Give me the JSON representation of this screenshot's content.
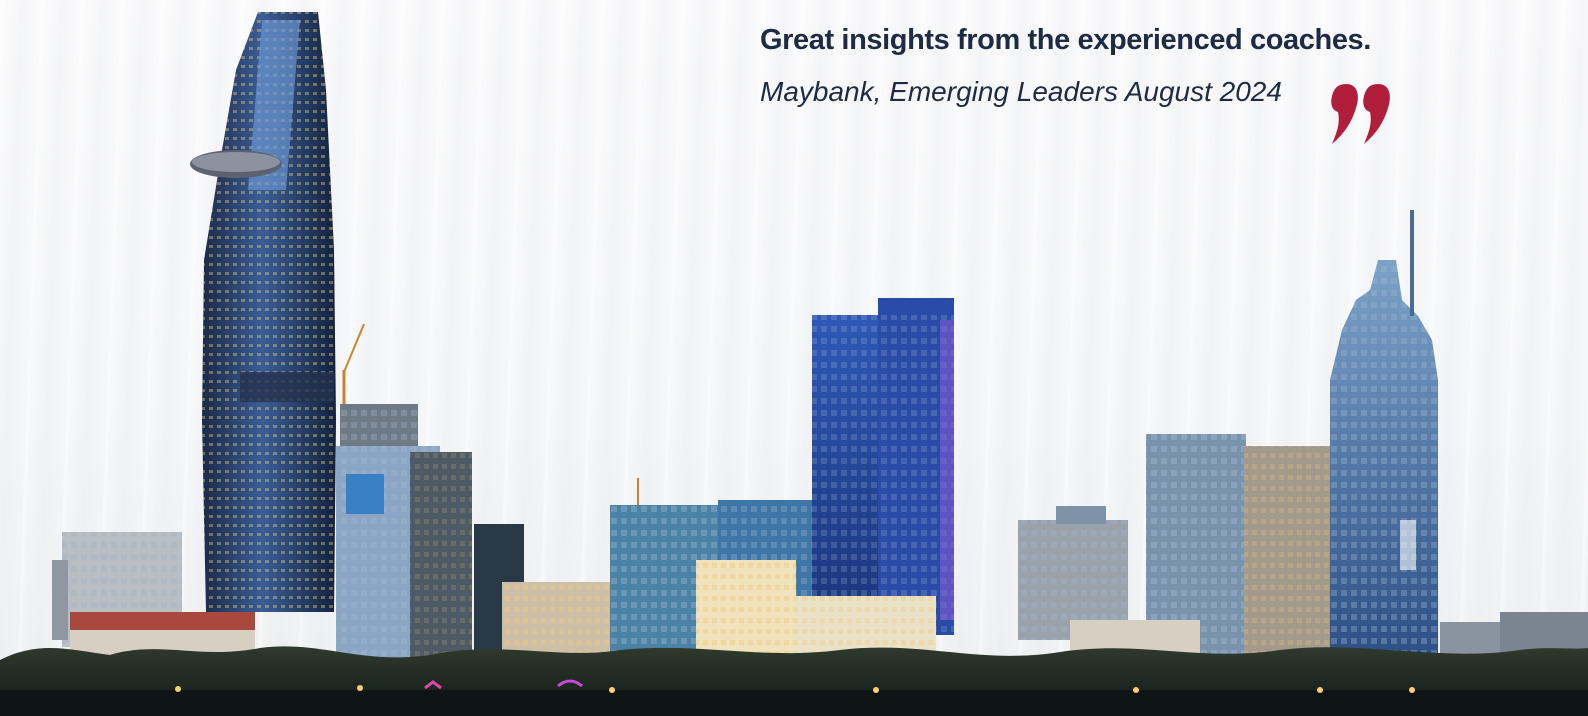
{
  "testimonial": {
    "quote": "Great insights from the experienced coaches.",
    "attribution": "Maybank, Emerging Leaders August 2024"
  },
  "colors": {
    "text": "#1f2a44",
    "quote_mark": "#b01e3c"
  },
  "icons": {
    "quote_mark": "closing-quote-icon",
    "background": "city-skyline-image"
  }
}
